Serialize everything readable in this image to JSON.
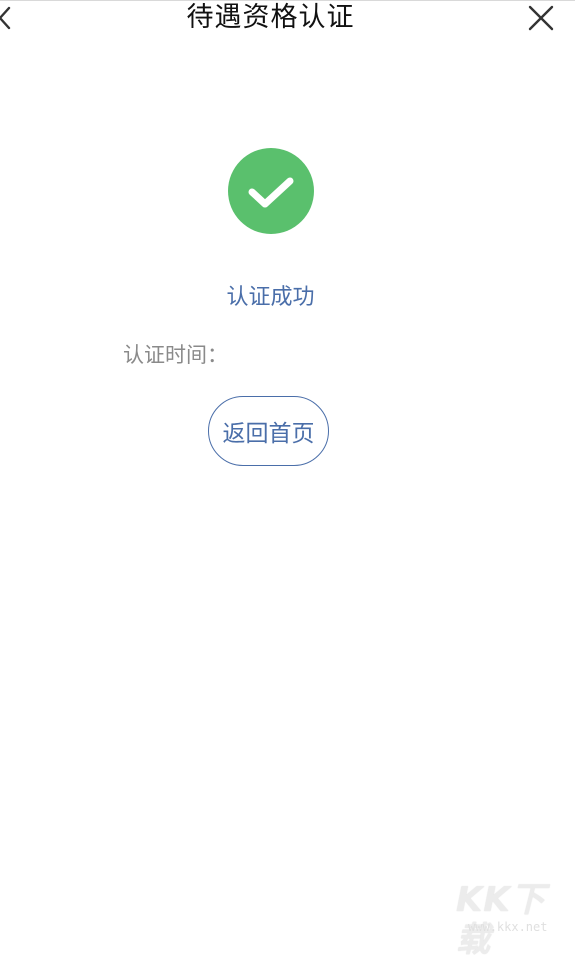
{
  "header": {
    "title": "待遇资格认证",
    "back_icon": "chevron-left-icon",
    "close_icon": "close-icon"
  },
  "result": {
    "icon": "check-circle-icon",
    "icon_color": "#5ac06d",
    "status": "认证成功",
    "status_color": "#4a6ea9"
  },
  "time": {
    "label": "认证时间：",
    "value": ""
  },
  "actions": {
    "home_label": "返回首页"
  },
  "watermark": {
    "logo": "KK下载",
    "url": "www.kkx.net"
  }
}
